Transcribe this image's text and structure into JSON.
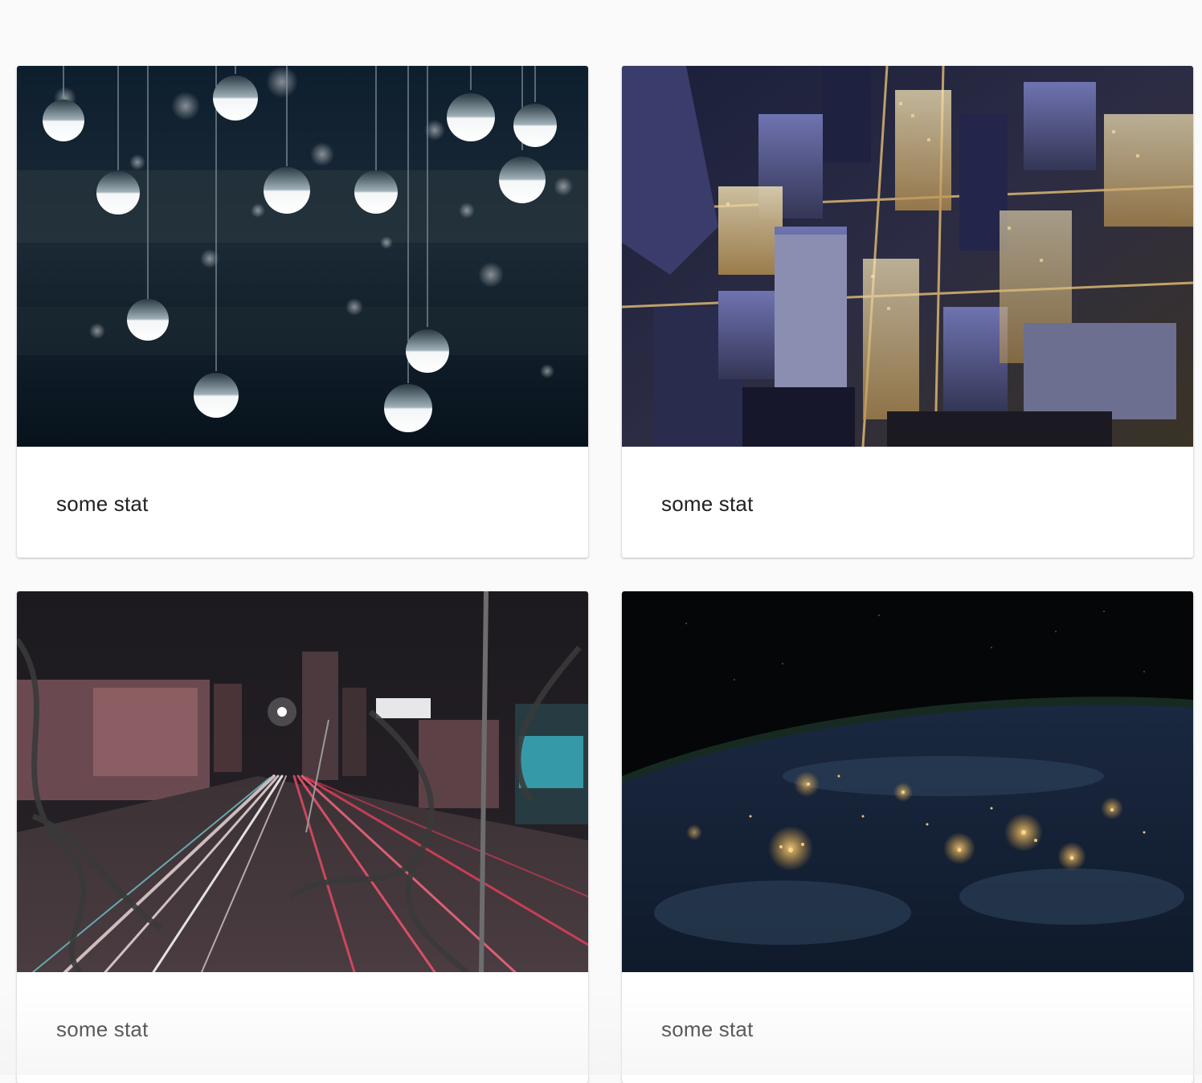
{
  "cards": [
    {
      "stat_label": "some stat",
      "image": "hanging-bulbs-photo"
    },
    {
      "stat_label": "some stat",
      "image": "city-aerial-night-photo"
    },
    {
      "stat_label": "some stat",
      "image": "highway-light-trails-photo"
    },
    {
      "stat_label": "some stat",
      "image": "earth-night-lights-photo"
    }
  ]
}
